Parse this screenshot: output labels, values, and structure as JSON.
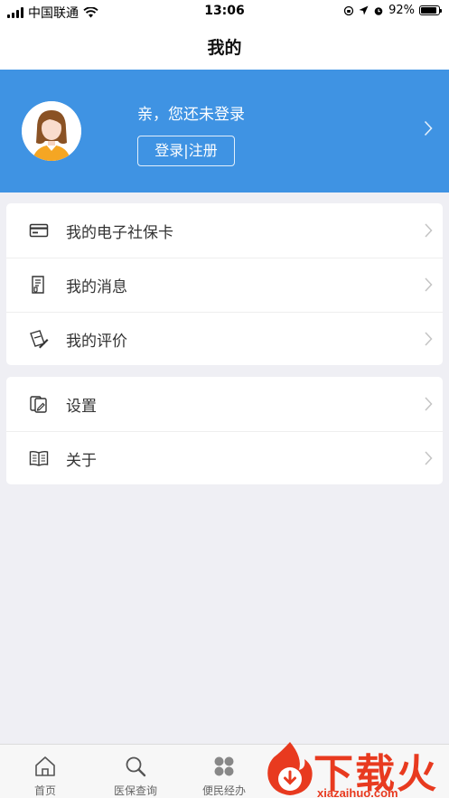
{
  "status_bar": {
    "carrier": "中国联通",
    "time": "13:06",
    "battery": "92%",
    "battery_level": 0.92
  },
  "nav": {
    "title": "我的"
  },
  "profile": {
    "greeting": "亲，您还未登录",
    "login_label": "登录|注册"
  },
  "menu_group_1": [
    {
      "label": "我的电子社保卡",
      "icon": "card-icon"
    },
    {
      "label": "我的消息",
      "icon": "message-icon"
    },
    {
      "label": "我的评价",
      "icon": "review-icon"
    }
  ],
  "menu_group_2": [
    {
      "label": "设置",
      "icon": "settings-icon"
    },
    {
      "label": "关于",
      "icon": "book-icon"
    }
  ],
  "tabs": [
    {
      "label": "首页",
      "icon": "home-icon"
    },
    {
      "label": "医保查询",
      "icon": "search-icon"
    },
    {
      "label": "便民经办",
      "icon": "grid-icon"
    }
  ],
  "watermark": {
    "text": "下载火",
    "url": "xiazaihuo.com"
  },
  "colors": {
    "header_blue": "#3f93e3",
    "background": "#efeff4",
    "watermark_red": "#e83a1f"
  }
}
